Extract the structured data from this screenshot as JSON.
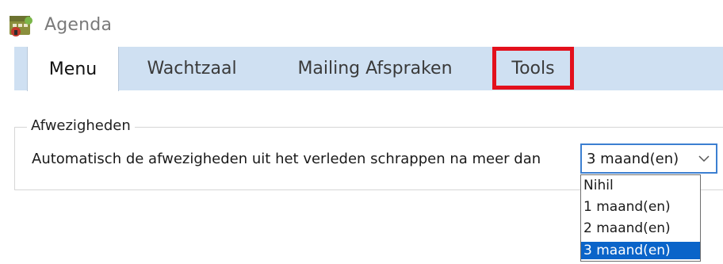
{
  "window": {
    "title": "Agenda",
    "icon": "agenda-app-icon"
  },
  "tabs": [
    {
      "label": "Menu",
      "active": true
    },
    {
      "label": "Wachtzaal",
      "active": false
    },
    {
      "label": "Mailing Afspraken",
      "active": false
    },
    {
      "label": "Tools",
      "active": false,
      "highlighted": true
    }
  ],
  "absences": {
    "group_title": "Afwezigheden",
    "setting_label": "Automatisch de afwezigheden uit het verleden schrappen na meer dan",
    "selected_value": "3 maand(en)",
    "options": [
      "Nihil",
      "1 maand(en)",
      "2 maand(en)",
      "3 maand(en)"
    ],
    "selected_index": 3
  },
  "colors": {
    "tab_strip": "#cfe0f2",
    "highlight_border": "#e3101c",
    "select_border": "#3c7fd1",
    "selected_option": "#0a64c9"
  }
}
